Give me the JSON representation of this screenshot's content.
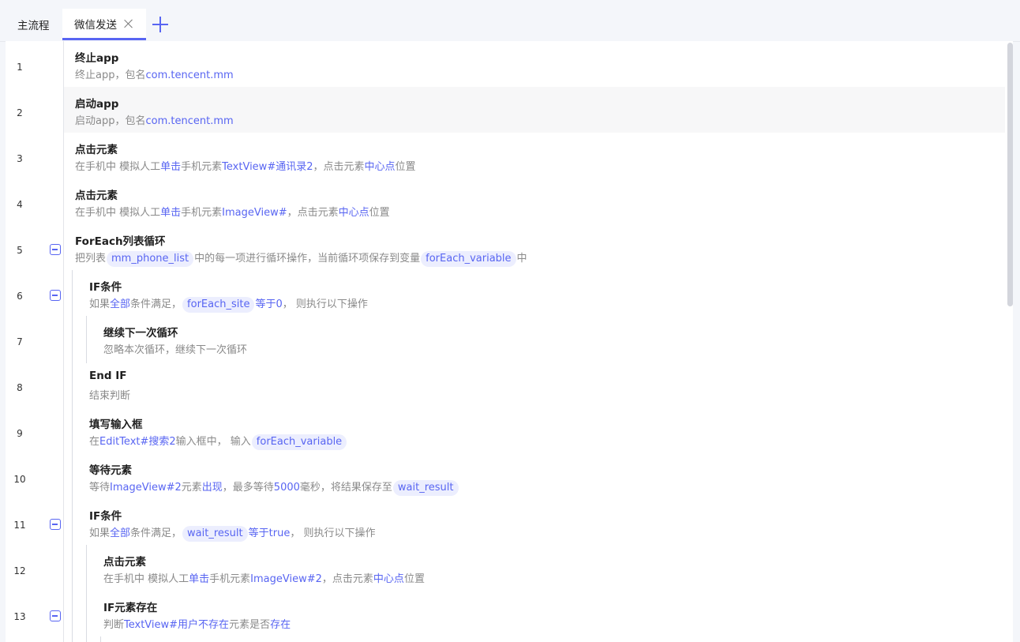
{
  "tabs": {
    "main": "主流程",
    "active": "微信发送"
  },
  "rows": [
    {
      "num": "1",
      "title": "终止app",
      "desc": [
        "终止app，包名",
        {
          "b": "com.tencent.mm"
        }
      ]
    },
    {
      "num": "2",
      "title": "启动app",
      "desc": [
        "启动app，包名",
        {
          "b": "com.tencent.mm"
        }
      ]
    },
    {
      "num": "3",
      "title": "点击元素",
      "desc": [
        "在手机中 模拟人工",
        {
          "b": "单击"
        },
        "手机元素",
        {
          "b": "TextView#通讯录2"
        },
        "，点击元素",
        {
          "b": "中心点"
        },
        "位置"
      ]
    },
    {
      "num": "4",
      "title": "点击元素",
      "desc": [
        "在手机中 模拟人工",
        {
          "b": "单击"
        },
        "手机元素",
        {
          "b": "ImageView#"
        },
        "，点击元素",
        {
          "b": "中心点"
        },
        "位置"
      ]
    },
    {
      "num": "5",
      "title": "ForEach列表循环",
      "desc": [
        "把列表",
        {
          "c": "mm_phone_list"
        },
        "中的每一项进行循环操作，当前循环项保存到变量",
        {
          "c": "forEach_variable"
        },
        "中"
      ]
    },
    {
      "num": "6",
      "title": "IF条件",
      "desc": [
        "如果",
        {
          "b": "全部"
        },
        "条件满足，",
        {
          "c": "forEach_site"
        },
        {
          "b": "等于"
        },
        {
          "b": "0"
        },
        "，  则执行以下操作"
      ]
    },
    {
      "num": "7",
      "title": "继续下一次循环",
      "desc": [
        "忽略本次循环，继续下一次循环"
      ]
    },
    {
      "num": "8",
      "title": "End IF",
      "desc": [
        "结束判断"
      ]
    },
    {
      "num": "9",
      "title": "填写输入框",
      "desc": [
        "在",
        {
          "b": "EditText#搜索2"
        },
        "输入框中，  输入",
        {
          "c": "forEach_variable"
        }
      ]
    },
    {
      "num": "10",
      "title": "等待元素",
      "desc": [
        "等待",
        {
          "b": "ImageView#2"
        },
        "元素",
        {
          "b": "出现"
        },
        "，最多等待",
        {
          "b": "5000"
        },
        "毫秒，将结果保存至",
        {
          "c": "wait_result"
        }
      ]
    },
    {
      "num": "11",
      "title": "IF条件",
      "desc": [
        "如果",
        {
          "b": "全部"
        },
        "条件满足，",
        {
          "c": "wait_result"
        },
        {
          "b": "等于"
        },
        {
          "b": "true"
        },
        "，  则执行以下操作"
      ]
    },
    {
      "num": "12",
      "title": "点击元素",
      "desc": [
        "在手机中 模拟人工",
        {
          "b": "单击"
        },
        "手机元素",
        {
          "b": "ImageView#2"
        },
        "，点击元素",
        {
          "b": "中心点"
        },
        "位置"
      ]
    },
    {
      "num": "13",
      "title": "IF元素存在",
      "desc": [
        "判断",
        {
          "b": "TextView#用户不存在"
        },
        "元素是否",
        {
          "b": "存在"
        }
      ]
    }
  ],
  "colors": {
    "accent": "#5865f2",
    "chip_bg": "#eceefe",
    "row_highlight": "#f7f7f8"
  },
  "icons": {
    "close": "close-icon",
    "add": "plus-icon",
    "fold": "collapse-minus-icon"
  }
}
